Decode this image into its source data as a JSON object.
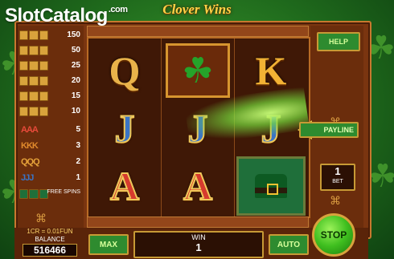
{
  "game": {
    "title": "Clover Wins",
    "watermark": "SlotCatalog",
    "watermark_suffix": ".com"
  },
  "paytable": {
    "rows": [
      {
        "symbol": "bar-symbol",
        "pay": "150"
      },
      {
        "symbol": "bar-symbol",
        "pay": "50"
      },
      {
        "symbol": "bar-symbol",
        "pay": "25"
      },
      {
        "symbol": "bar-symbol",
        "pay": "20"
      },
      {
        "symbol": "bar-symbol",
        "pay": "15"
      },
      {
        "symbol": "bar-symbol",
        "pay": "10"
      },
      {
        "symbol": "AAA",
        "pay": "5"
      },
      {
        "symbol": "KKK",
        "pay": "3"
      },
      {
        "symbol": "QQQ",
        "pay": "2"
      },
      {
        "symbol": "JJJ",
        "pay": "1"
      }
    ],
    "free_spins_label": "FREE SPINS"
  },
  "reels": [
    [
      "Q",
      "J",
      "A"
    ],
    [
      "clover",
      "J",
      "A"
    ],
    [
      "K",
      "J",
      "hat"
    ]
  ],
  "controls": {
    "help_label": "HELP",
    "payline_label": "PAYLINE",
    "bet_value": "1",
    "bet_label": "BET",
    "max_label": "MAX",
    "auto_label": "AUTO",
    "stop_label": "STOP",
    "win_label": "WIN",
    "win_value": "1"
  },
  "account": {
    "coin_info": "1CR = 0.01FUN",
    "balance_label": "BALANCE",
    "balance_value": "516466"
  },
  "colors": {
    "frame": "#7a3510",
    "button_green": "#2e8b2f",
    "gold": "#c79a35"
  }
}
